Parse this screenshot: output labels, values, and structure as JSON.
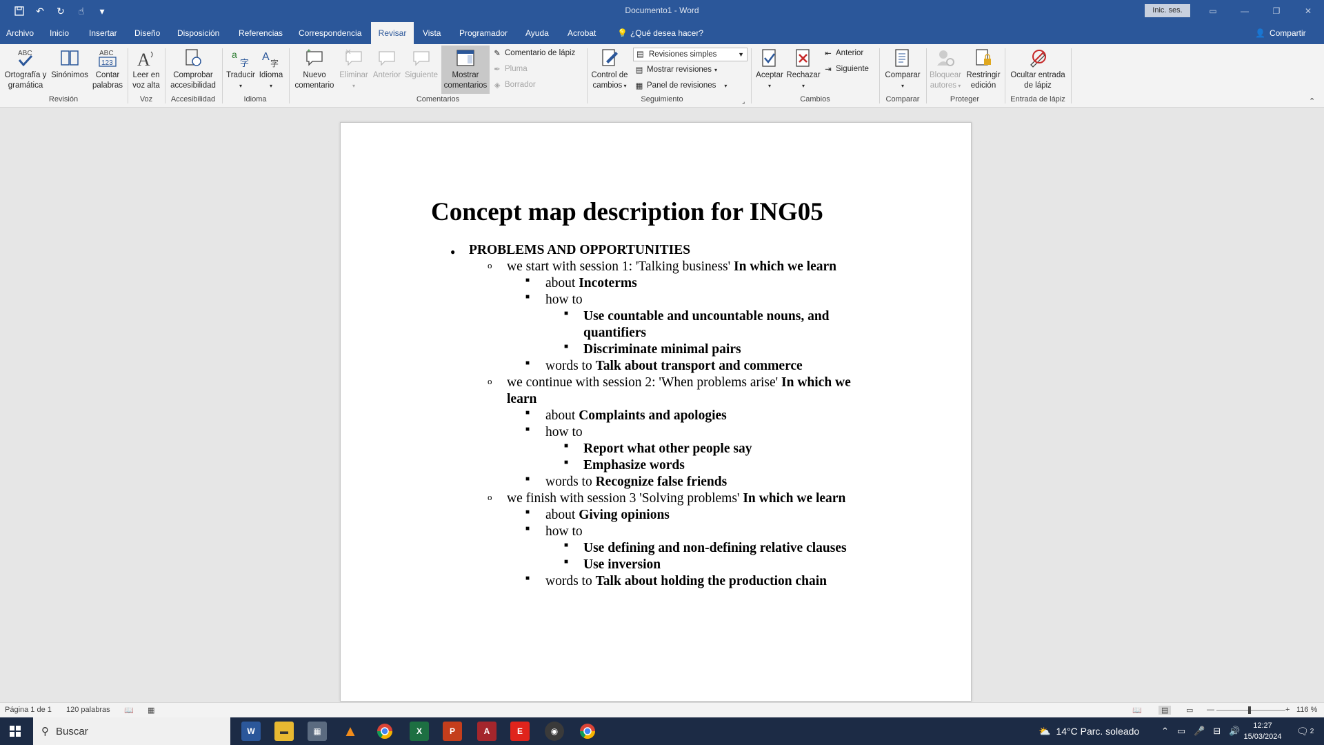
{
  "window": {
    "title": "Documento1 - Word",
    "sign_in": "Inic. ses."
  },
  "tabs": [
    "Archivo",
    "Inicio",
    "Insertar",
    "Diseño",
    "Disposición",
    "Referencias",
    "Correspondencia",
    "Revisar",
    "Vista",
    "Programador",
    "Ayuda",
    "Acrobat"
  ],
  "active_tab": "Revisar",
  "tell_me": "¿Qué desea hacer?",
  "share": "Compartir",
  "ribbon": {
    "ortografia": "Ortografía y gramática",
    "sinonimos": "Sinónimos",
    "contar": "Contar palabras",
    "leer": "Leer en voz alta",
    "comprobar": "Comprobar accesibilidad",
    "traducir": "Traducir",
    "idioma": "Idioma",
    "nuevo_comentario": "Nuevo comentario",
    "eliminar": "Eliminar",
    "anterior": "Anterior",
    "siguiente": "Siguiente",
    "mostrar_comentarios": "Mostrar comentarios",
    "comentario_lapiz": "Comentario de lápiz",
    "pluma": "Pluma",
    "borrador": "Borrador",
    "control_cambios": "Control de cambios",
    "revisiones_value": "Revisiones simples",
    "mostrar_revisiones": "Mostrar revisiones",
    "panel_revisiones": "Panel de revisiones",
    "aceptar": "Aceptar",
    "rechazar": "Rechazar",
    "cambios_anterior": "Anterior",
    "cambios_siguiente": "Siguiente",
    "comparar": "Comparar",
    "bloquear": "Bloquear autores",
    "restringir": "Restringir edición",
    "ocultar": "Ocultar entrada de lápiz",
    "groups": {
      "revision": "Revisión",
      "voz": "Voz",
      "accesibilidad": "Accesibilidad",
      "idioma": "Idioma",
      "comentarios": "Comentarios",
      "seguimiento": "Seguimiento",
      "cambios": "Cambios",
      "comparar": "Comparar",
      "proteger": "Proteger",
      "entrada_lapiz": "Entrada de lápiz"
    }
  },
  "document": {
    "title": "Concept map description for ING05",
    "l1": "PROBLEMS AND OPPORTUNITIES",
    "s1": {
      "pre": "we start with session 1: 'Talking business' ",
      "bold": "In which we learn"
    },
    "s1_about": {
      "pre": "about ",
      "bold": "Incoterms"
    },
    "s1_howto": "how to",
    "s1_h1a": "Use countable and uncountable nouns, and",
    "s1_h1b": "quantifiers",
    "s1_h2": "Discriminate minimal pairs",
    "s1_words": {
      "pre": "words to ",
      "bold": "Talk about transport and commerce"
    },
    "s2": {
      "pre": "we continue with session 2: 'When problems arise' ",
      "bold": "In which we",
      "bold2": "learn"
    },
    "s2_about": {
      "pre": "about ",
      "bold": "Complaints and apologies"
    },
    "s2_howto": "how to",
    "s2_h1": "Report what other people say",
    "s2_h2": "Emphasize words",
    "s2_words": {
      "pre": "words to ",
      "bold": "Recognize false friends"
    },
    "s3": {
      "pre": "we finish with session 3 'Solving problems' ",
      "bold": "In which we learn"
    },
    "s3_about": {
      "pre": "about ",
      "bold": "Giving opinions"
    },
    "s3_howto": "how to",
    "s3_h1": "Use defining and non-defining relative clauses",
    "s3_h2": "Use inversion",
    "s3_words": {
      "pre": "words to ",
      "bold": "Talk about holding the production chain"
    }
  },
  "status": {
    "page": "Página 1 de 1",
    "words": "120 palabras",
    "zoom": "116 %"
  },
  "taskbar": {
    "search": "Buscar",
    "weather": "14°C  Parc. soleado",
    "time": "12:27",
    "date": "15/03/2024",
    "notif_count": "2"
  }
}
